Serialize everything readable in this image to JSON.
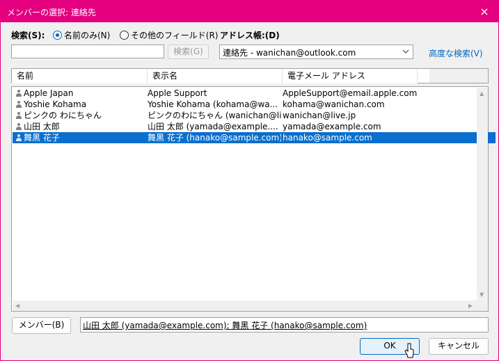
{
  "dialog": {
    "title": "メンバーの選択: 連絡先",
    "close_icon": "×"
  },
  "search": {
    "label": "検索(S):",
    "option_name_only": "名前のみ(N)",
    "option_other_fields": "その他のフィールド(R)",
    "selected_option": "名前のみ(N)",
    "input_value": "",
    "search_button": "検索(G)"
  },
  "address_book": {
    "label": "アドレス帳:(D)",
    "selected": "連絡先 - wanichan@outlook.com",
    "advanced_search": "高度な検索(V)"
  },
  "table": {
    "headers": [
      "名前",
      "表示名",
      "電子メール アドレス"
    ],
    "rows": [
      {
        "name": "Apple Japan",
        "display": "Apple Support",
        "email": "AppleSupport@email.apple.com",
        "selected": false
      },
      {
        "name": "Yoshie Kohama",
        "display": "Yoshie Kohama (kohama@wa...",
        "email": "kohama@wanichan.com",
        "selected": false
      },
      {
        "name": "ピンクの わにちゃん",
        "display": "ピンクのわにちゃん (wanichan@live....",
        "email": "wanichan@live.jp",
        "selected": false
      },
      {
        "name": "山田 太郎",
        "display": "山田 太郎 (yamada@example....",
        "email": "yamada@example.com",
        "selected": false
      },
      {
        "name": "舞黒 花子",
        "display": "舞黒 花子 (hanako@sample.com)",
        "email": "hanako@sample.com",
        "selected": true
      }
    ]
  },
  "members": {
    "button": "メンバー(B)",
    "value": "山田 太郎 (yamada@example.com); 舞黒 花子 (hanako@sample.com)"
  },
  "footer": {
    "ok": "OK",
    "cancel": "キャンセル"
  }
}
